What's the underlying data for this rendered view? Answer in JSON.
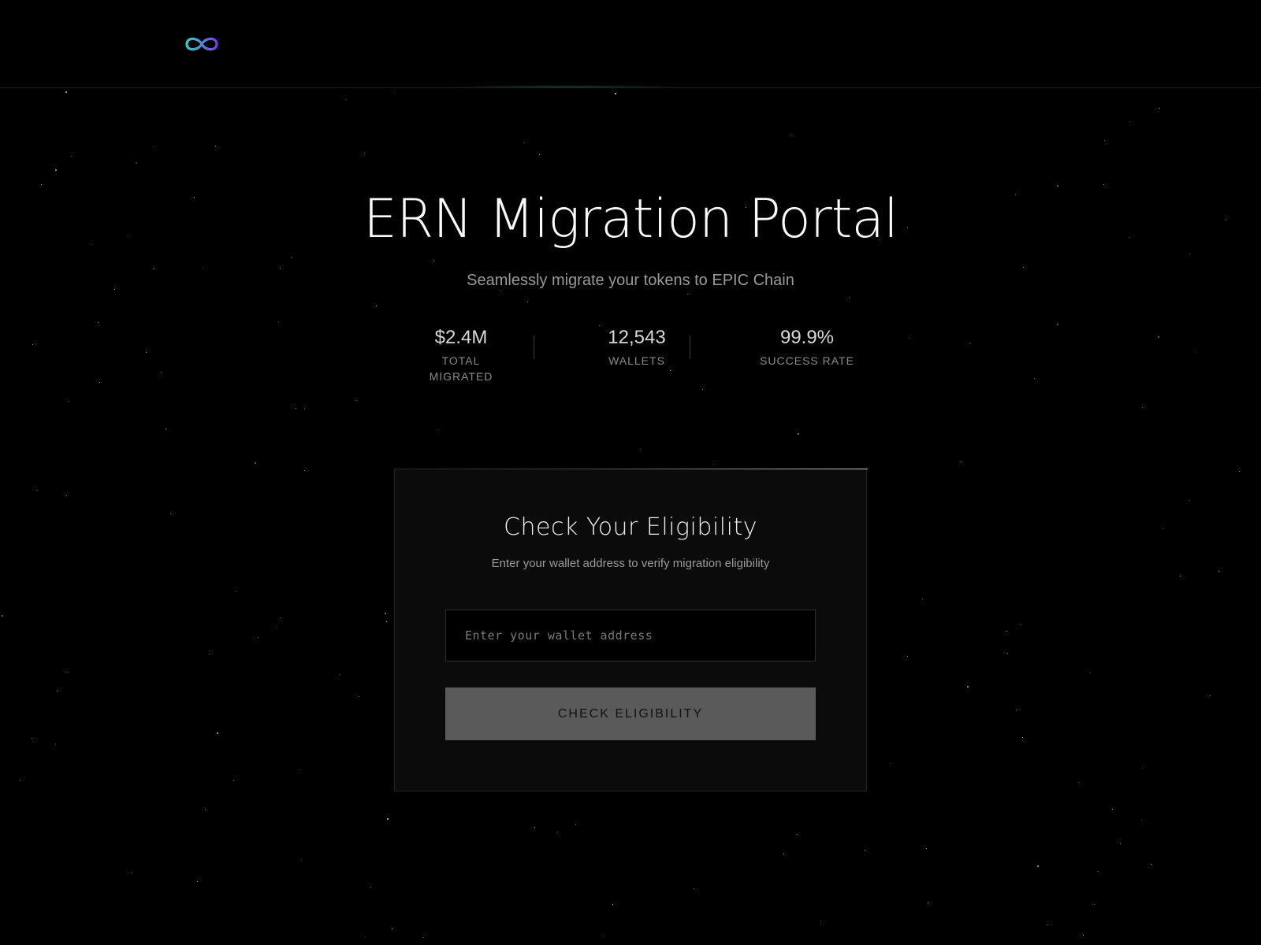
{
  "header": {
    "logo_icon": "infinity-logo-icon",
    "logo_gradient": [
      "#2ed3c6",
      "#7b3cf0"
    ]
  },
  "hero": {
    "title": "ERN Migration Portal",
    "subtitle": "Seamlessly migrate your tokens to EPIC Chain"
  },
  "stats": [
    {
      "value": "$2.4M",
      "label": "TOTAL MIGRATED"
    },
    {
      "value": "12,543",
      "label": "WALLETS"
    },
    {
      "value": "99.9%",
      "label": "SUCCESS RATE"
    }
  ],
  "eligibility": {
    "title": "Check Your Eligibility",
    "subtitle": "Enter your wallet address to verify migration eligibility",
    "input_placeholder": "Enter your wallet address",
    "input_value": "",
    "button_label": "CHECK ELIGIBILITY"
  },
  "colors": {
    "background": "#000000",
    "card_background": "#0b0b0b",
    "button_background": "#5a5a5a"
  }
}
